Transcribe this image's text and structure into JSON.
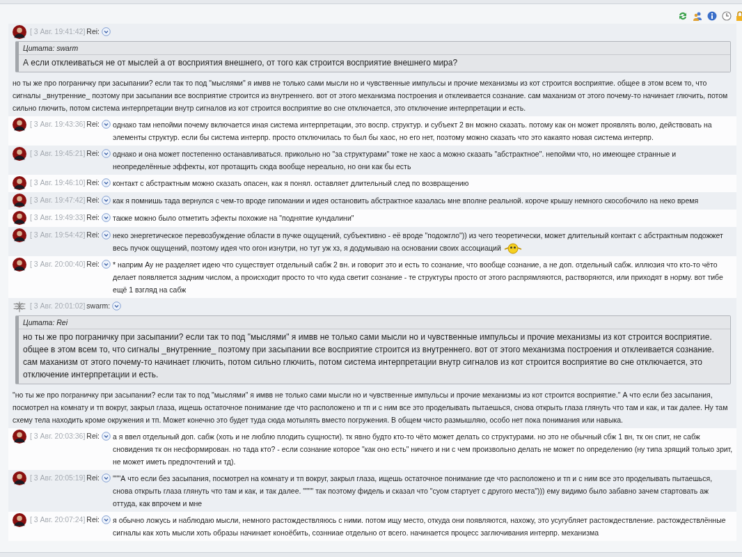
{
  "messages": [
    {
      "kind": "block",
      "time": "[ 3 Авг. 19:41:42]",
      "author": "Rei:",
      "avatar": {
        "kind": "photo"
      },
      "quote": {
        "label": "Цитата: swarm",
        "text": "А если отклеиваться не от мыслей а от восприятия внешнего, от того как строится восприятие внешнего мира?"
      },
      "text": "но ты же про пограничку при засыпании? если так то под \"мыслями\" я имвв не только сами мысли но и чувственные импульсы и прочие механизмы из кот строится восприятие. общее в этом всем то, что сигналы _внутренние_ поэтому при засыпании все восприятие строится из внутреннего. вот от этого механизма построения и отклеивается сознание. сам маханизм от этого почему-то начинает глючить, потом сильно глючить, потом система интерпретации внутр сигналов из кот строится восприятие во сне отключается, это отключение интерпретации и есть."
    },
    {
      "kind": "inline",
      "time": "[ 3 Авг. 19:43:36]",
      "author": "Rei:",
      "avatar": {
        "kind": "photo"
      },
      "text": "однако там непойми почему включается иная система интерпретации, это воспр. структур. и субъект 2 вн можно сказать. потому как он может проявлять волю, действовать на элементы структур. если бы система интерпр. просто отключилась то был бы хаос, но его нет, поэтому можно сказать что это какаято новая система интерпр."
    },
    {
      "kind": "inline",
      "time": "[ 3 Авг. 19:45:21]",
      "author": "Rei:",
      "avatar": {
        "kind": "photo"
      },
      "text": "однако и она может постепенно останавливаться. прикольно но \"за структурами\" тоже не хаос а можно сказать \"абстрактное\". непойми что, но имеющее странные и неопределённые эффекты, кот протащить сюда вообще нереально, но они как бы есть"
    },
    {
      "kind": "inline",
      "time": "[ 3 Авг. 19:46:10]",
      "author": "Rei:",
      "avatar": {
        "kind": "photo"
      },
      "text": "контакт с абстрактным можно сказать опасен, как я понял. оставляет длительный след по возвращению"
    },
    {
      "kind": "inline",
      "time": "[ 3 Авг. 19:47:42]",
      "author": "Rei:",
      "avatar": {
        "kind": "photo"
      },
      "text": "как я помнишь тада вернулся с чем-то вроде гипомании и идея остановить абстрактное казалась мне вполне реальной. короче крышу немного скособочило на неко время"
    },
    {
      "kind": "inline",
      "time": "[ 3 Авг. 19:49:33]",
      "author": "Rei:",
      "avatar": {
        "kind": "photo"
      },
      "text": "также можно было отметить эфекты похожие на \"поднятие кундалини\""
    },
    {
      "kind": "inline",
      "time": "[ 3 Авг. 19:54:42]",
      "author": "Rei:",
      "avatar": {
        "kind": "photo"
      },
      "text": "неко энергетическое перевозбуждение области в пучке ощущений, субъективно - её вроде \"подожгло\")) из чего теоретически, может длительный контакт с абстрактным подожжет весь пучок ощущений, поэтому идея что огон изнутри, но тут уж хз, я додумываю на основании своих ассоциаций",
      "smiley": true
    },
    {
      "kind": "inline",
      "time": "[ 3 Авг. 20:00:40]",
      "author": "Rei:",
      "avatar": {
        "kind": "photo"
      },
      "text": "* наприм Ау не разделяет идею что существует отдельный сабж 2 вн. и говорит это и есть то сознание, что вообще сознание, а не доп. отдельный сабж. иллюзия что кто-то чёто делает появляется задним числом, а происходит просто то что куда светит сознание - те структуры просто от этого распрямляются, растворяются, или приходят в норму. вот тибе ещё 1 взгляд на сабж"
    },
    {
      "kind": "block",
      "time": "[ 3 Авг. 20:01:02]",
      "author": "swarm:",
      "avatar": {
        "kind": "sketch"
      },
      "quote": {
        "label": "Цитата: Rei",
        "text": "но ты же про пограничку при засыпании? если так то под \"мыслями\" я имвв не только сами мысли но и чувственные импульсы и прочие механизмы из кот строится восприятие. общее в этом всем то, что сигналы _внутренние_ поэтому при засыпании все восприятие строится из внутреннего. вот от этого механизма построения и отклеивается сознание. сам маханизм от этого почему-то начинает глючить, потом сильно глючить, потом система интерпретации внутр сигналов из кот строится восприятие во сне отключается, это отключение интерпретации и есть."
      },
      "text": "\"но ты же про пограничку при засыпании? если так то под \"мыслями\" я имвв не только сами мысли но и чувственные импульсы и прочие механизмы из кот строится восприятие.\" А что если без засыпания, посмотрел на комнату и тп вокруг, закрыл глаза, ищешь остаточное понимание где что расположено и тп и с ним все это проделывать пытаешься, снова открыть глаза глянуть что там и как, и так далее. Ну там схему тела находить кроме окружения и тп. Может конечно это будет туда сюда мотылять вместо погружения. В общем чисто размышляю, особо нет пока понимания или навыка."
    },
    {
      "kind": "inline",
      "time": "[ 3 Авг. 20:03:36]",
      "author": "Rei:",
      "avatar": {
        "kind": "photo"
      },
      "text": "а я ввел отдельный доп. сабж (хоть и не люблю плодить сущности). тк явно будто кто-то чёто может делать со структурами. но это не обычный сбж 1 вн, тк он спит, не сабж сновидения тк он несформирован. но тада кто? - если сознание которое \"как оно есть\" ничего и ни с чем произвольно делать не может по определению (ну типа зрящий только зрит, не может иметь предпочтений и тд)."
    },
    {
      "kind": "inline",
      "time": "[ 3 Авг. 20:05:19]",
      "author": "Rei:",
      "avatar": {
        "kind": "photo"
      },
      "text": "\"\"\"А что если без засыпания, посмотрел на комнату и тп вокруг, закрыл глаза, ищешь остаточное понимание где что расположено и тп и с ним все это проделывать пытаешься, снова открыть глаза глянуть что там и как, и так далее. \"\"\"\" так поэтому фидель и сказал что \"суом стартует с другого места\"))) ему видимо было забавно зачем стартовать аж оттуда, как впрочем и мне"
    },
    {
      "kind": "inline",
      "time": "[ 3 Авг. 20:07:24]",
      "author": "Rei:",
      "avatar": {
        "kind": "photo"
      },
      "text": "я обычно ложусь и наблюдаю мысли, немного растождествляюсь с ними. потом ищу место, откуда они появляются, нахожу, это усугубляет растождествление. растождествлённые сигналы как хоть мысли хоть образы начинает коноёбить, сознниае отдельно от всего. начинается процесс заглючивания интерпр. механизма"
    }
  ]
}
